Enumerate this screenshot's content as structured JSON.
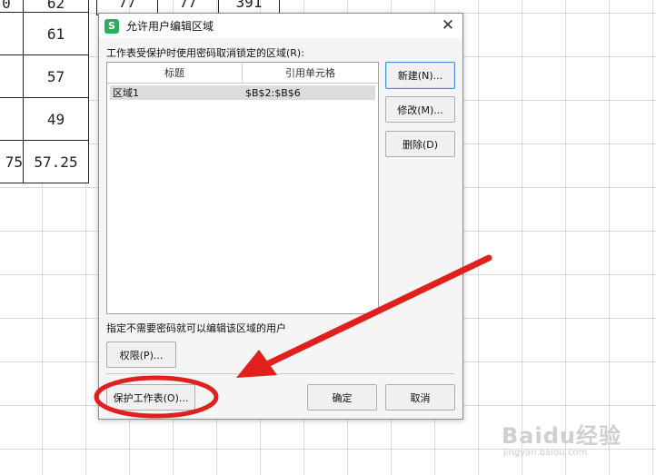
{
  "sheet": {
    "top_partial": [
      "0",
      "62"
    ],
    "top_extra": [
      "77",
      "77",
      "391"
    ],
    "rows": [
      {
        "a": "",
        "b": "61"
      },
      {
        "a": "",
        "b": "57"
      },
      {
        "a": "",
        "b": "49"
      },
      {
        "a": "75",
        "b": "57.25"
      }
    ]
  },
  "dialog": {
    "title": "允许用户编辑区域",
    "app_icon": "S",
    "close": "✕",
    "list_caption": "工作表受保护时使用密码取消锁定的区域(R):",
    "columns": [
      "标题",
      "引用单元格"
    ],
    "rows": [
      {
        "title": "区域1",
        "ref": "$B$2:$B$6"
      }
    ],
    "buttons": {
      "new": "新建(N)...",
      "modify": "修改(M)...",
      "delete": "删除(D)",
      "permissions": "权限(P)...",
      "protect_sheet": "保护工作表(O)...",
      "ok": "确定",
      "cancel": "取消"
    },
    "users_caption": "指定不需要密码就可以编辑该区域的用户"
  },
  "watermark": {
    "logo": "Baidu经验",
    "url": "jingyan.baidu.com"
  },
  "colors": {
    "annotation_red": "#e0201c",
    "accent_blue": "#4a8fd6",
    "app_icon_green": "#2cad5b"
  }
}
